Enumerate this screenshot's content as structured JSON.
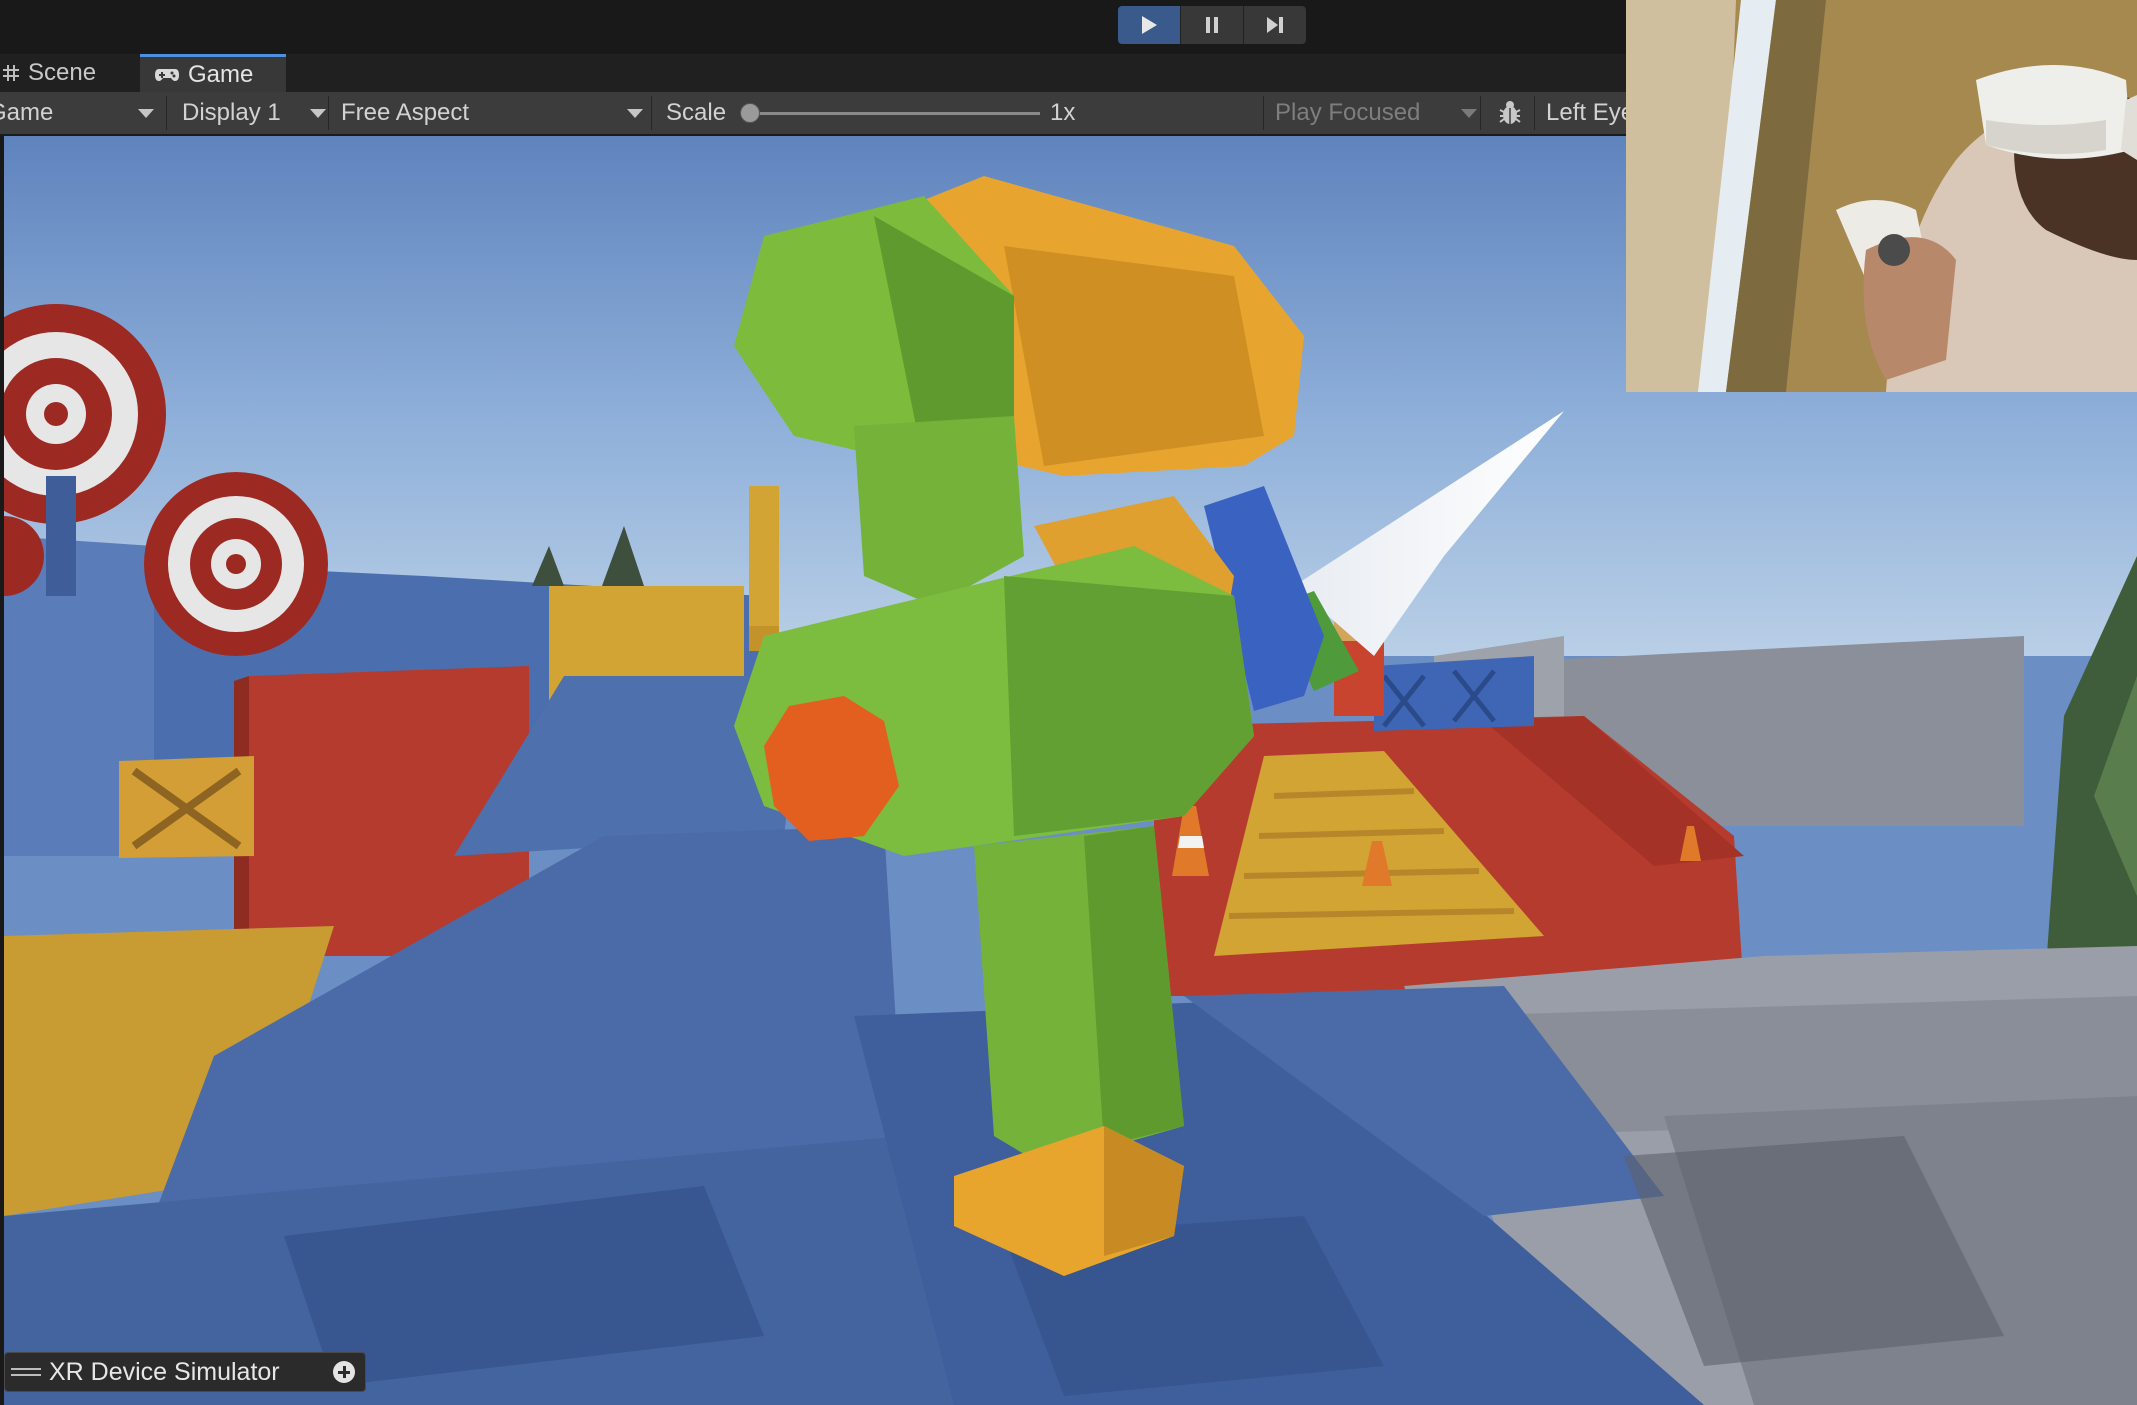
{
  "toolbar_top": {
    "play_icon": "play-icon",
    "pause_icon": "pause-icon",
    "step_icon": "step-forward-icon",
    "play_active_color": "#3a5a8c"
  },
  "tabs": {
    "scene": "Scene",
    "scene_icon": "grid-icon",
    "game": "Game",
    "game_icon": "gamepad-icon"
  },
  "game_toolbar": {
    "mode": "Game",
    "display": "Display 1",
    "aspect": "Free Aspect",
    "scale_label": "Scale",
    "scale_value": "1x",
    "play_mode": "Play Focused",
    "debug_icon": "bug-icon",
    "eye": "Left Eye"
  },
  "xr_simulator": {
    "label": "XR Device Simulator",
    "add_icon": "plus-circle-icon"
  },
  "webcam": {
    "description_icon": "webcam-overlay"
  }
}
